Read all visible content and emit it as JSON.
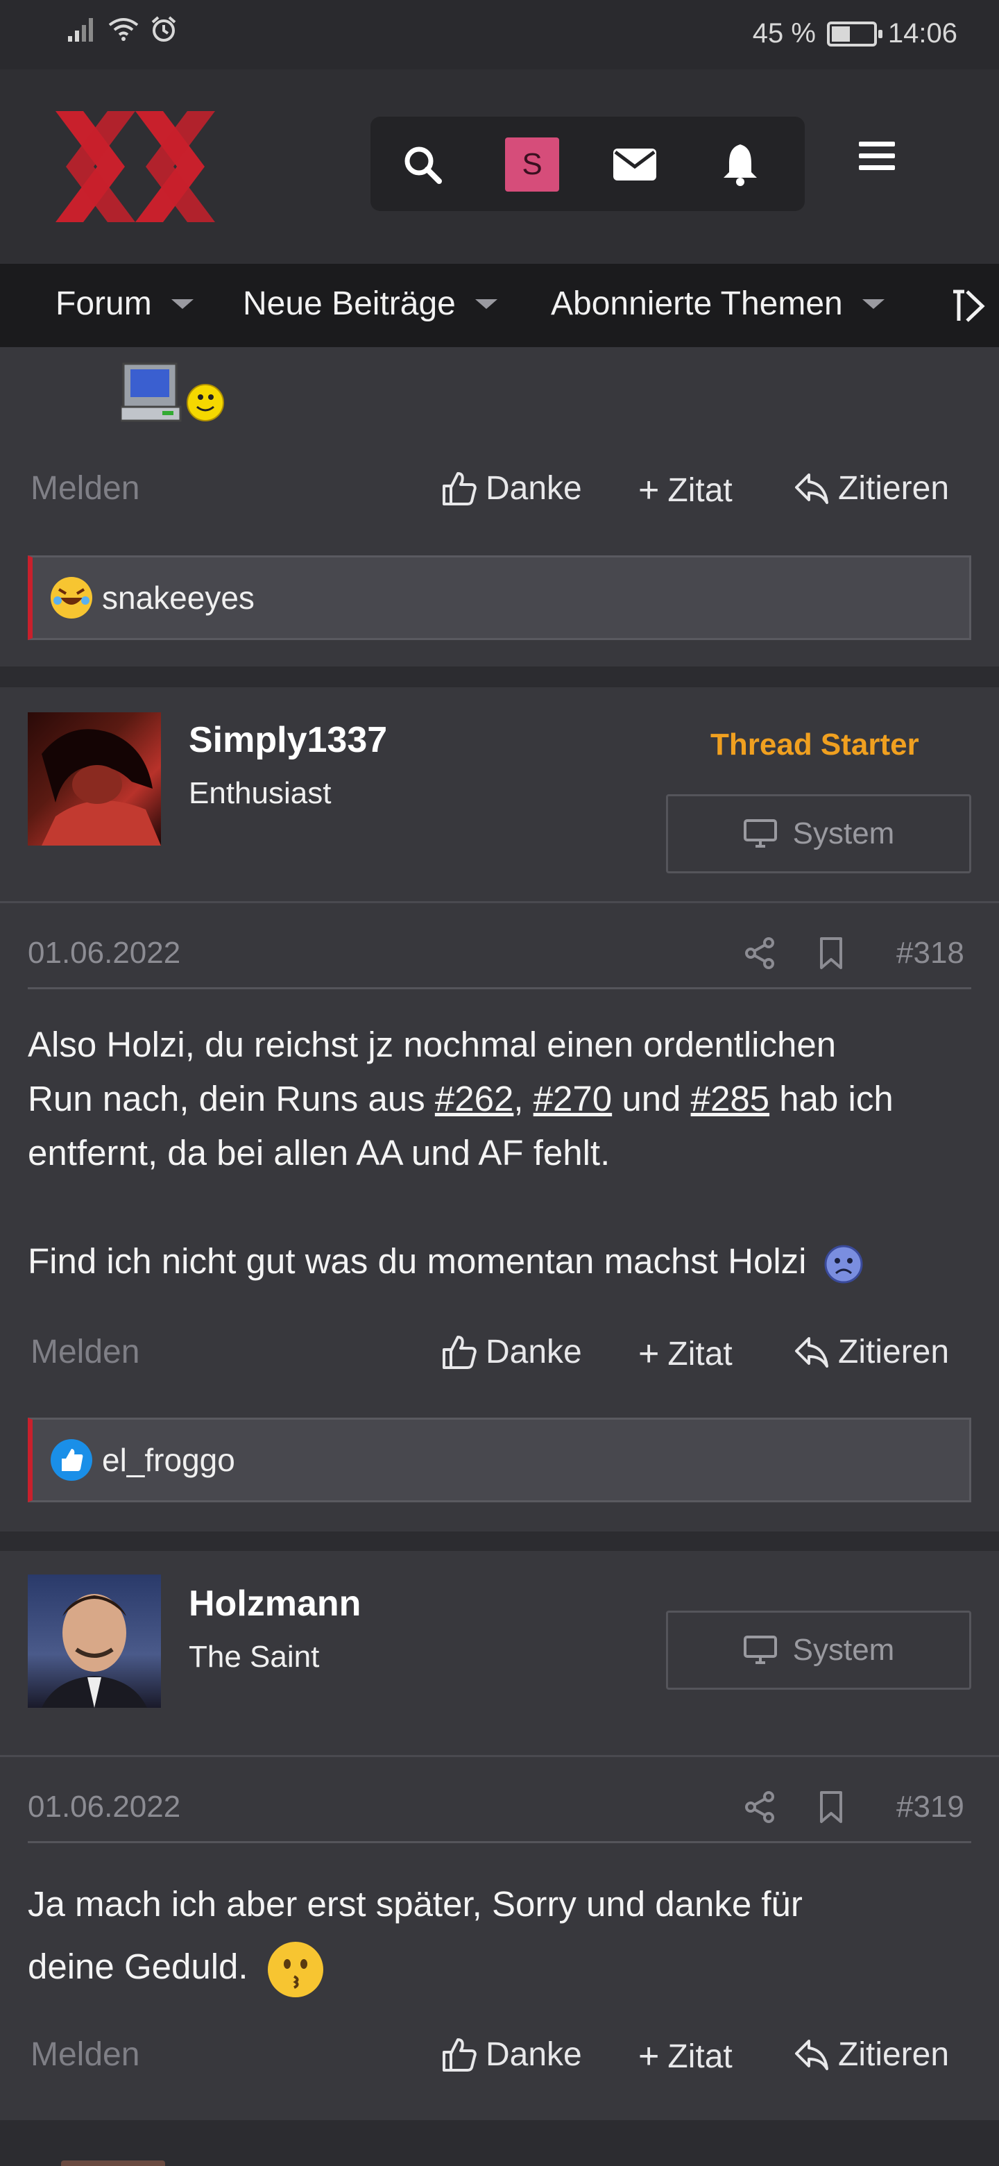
{
  "status_bar": {
    "battery": "45 %",
    "battery_level": 0.45,
    "time": "14:06"
  },
  "header": {
    "user_initial": "S",
    "colors": {
      "logo_red": "#c8202c",
      "avatar_bg": "#d64d7a",
      "accent_orange": "#f0a020"
    }
  },
  "nav": {
    "items": [
      {
        "label": "Forum"
      },
      {
        "label": "Neue Beiträge"
      },
      {
        "label": "Abonnierte Themen"
      }
    ]
  },
  "actions": {
    "report": "Melden",
    "thanks": "Danke",
    "quote_add": "Zitat",
    "reply": "Zitieren"
  },
  "posts": [
    {
      "reaction_user": "snakeeyes"
    },
    {
      "username": "Simply1337",
      "user_title": "Enthusiast",
      "badge": "Thread Starter",
      "system_label": "System",
      "date": "01.06.2022",
      "number": "#318",
      "body_line1": "Also Holzi, du reichst jz nochmal einen ordentlichen",
      "body_line2_prefix": "Run nach, dein Runs aus ",
      "link1": "#262",
      "comma": ", ",
      "link2": "#270",
      "and": " und ",
      "link3": "#285",
      "body_line2_suffix": " hab ich",
      "body_line3": "entfernt, da bei allen AA und AF fehlt.",
      "body_line4": "Find ich nicht gut was du momentan machst Holzi",
      "reaction_user": "el_froggo"
    },
    {
      "username": "Holzmann",
      "user_title": "The Saint",
      "system_label": "System",
      "date": "01.06.2022",
      "number": "#319",
      "body_line1": "Ja mach ich aber erst später, Sorry und danke für",
      "body_line2": "deine Geduld."
    }
  ]
}
